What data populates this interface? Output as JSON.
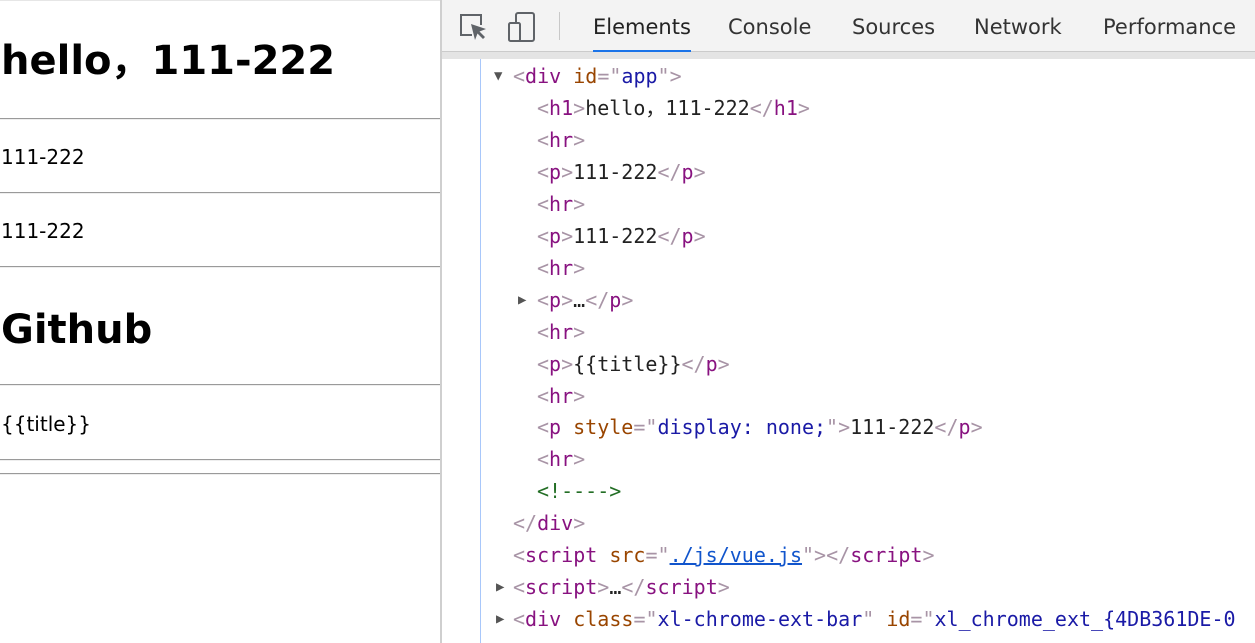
{
  "page": {
    "heading1": "hello，111-222",
    "para1": "111-222",
    "para2": "111-222",
    "heading2": "Github",
    "para3": "{{title}}"
  },
  "devtools": {
    "tabs": [
      "Elements",
      "Console",
      "Sources",
      "Network",
      "Performance"
    ],
    "active_tab": "Elements",
    "icons": [
      "inspect-element-icon",
      "device-toggle-icon"
    ],
    "tree": {
      "div_open": {
        "tag": "div",
        "attr": "id",
        "value": "app"
      },
      "h1": {
        "tag": "h1",
        "text": "hello，111-222"
      },
      "hr": "hr",
      "p1": {
        "tag": "p",
        "text": "111-222"
      },
      "p2": {
        "tag": "p",
        "text": "111-222"
      },
      "p_collapsed": {
        "tag": "p",
        "ellipsis": "…"
      },
      "p_title": {
        "tag": "p",
        "text": "{{title}}"
      },
      "p_hidden": {
        "tag": "p",
        "attr": "style",
        "value": "display: none;",
        "text": "111-222"
      },
      "comment": "<!---->",
      "div_close": "div",
      "script_src": {
        "tag": "script",
        "attr": "src",
        "value": "./js/vue.js"
      },
      "script_collapsed": {
        "tag": "script",
        "ellipsis": "…"
      },
      "div_ext": {
        "tag": "div",
        "attr1": "class",
        "value1": "xl-chrome-ext-bar",
        "attr2": "id",
        "value2": "xl_chrome_ext_{4DB361DE-0"
      }
    },
    "colors": {
      "tag": "#881280",
      "attribute": "#994500",
      "attribute_value": "#1a1aa6",
      "comment": "#236e25",
      "active_tab_underline": "#1a73e8"
    }
  }
}
